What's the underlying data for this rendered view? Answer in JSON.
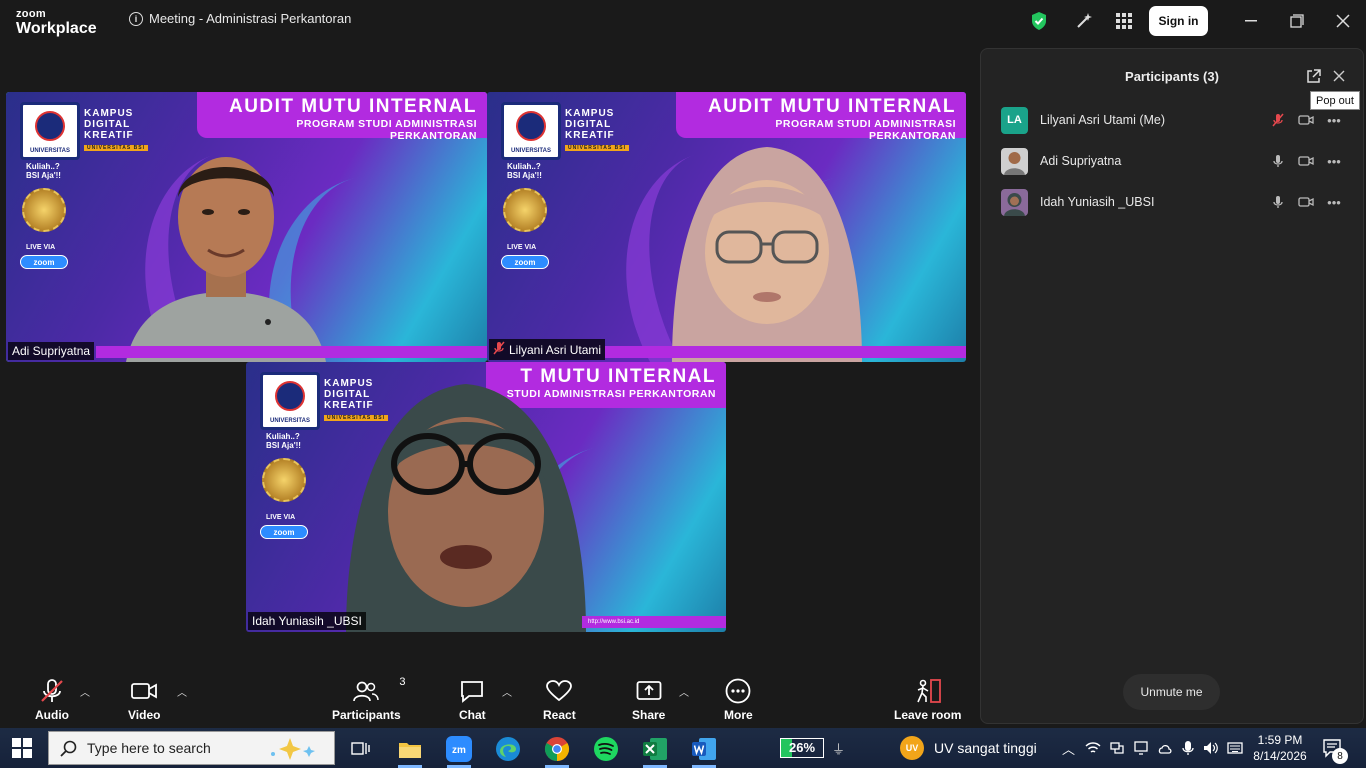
{
  "titlebar": {
    "logo_line1": "zoom",
    "logo_line2": "Workplace",
    "meeting_title": "Meeting - Administrasi Perkantoran",
    "signin_label": "Sign in"
  },
  "background_text": {
    "audit": "AUDIT MUTU INTERNAL",
    "audit_partial": "T MUTU INTERNAL",
    "program": "PROGRAM STUDI ADMINISTRASI PERKANTORAN",
    "program_partial": "STUDI ADMINISTRASI PERKANTORAN",
    "kampus": "KAMPUS",
    "digital": "DIGITAL",
    "kreatif": "KREATIF",
    "ubsi": "UNIVERSITAS BSI",
    "universitas": "UNIVERSITAS",
    "kuliah1": "Kuliah..?",
    "kuliah2": "BSI Aja'!!",
    "live_via": "LIVE VIA",
    "zoom": "zoom",
    "url": "http://www.bsi.ac.id"
  },
  "tiles": [
    {
      "name": "Adi Supriyatna",
      "muted": false
    },
    {
      "name": "Lilyani Asri Utami",
      "muted": true
    },
    {
      "name": "Idah Yuniasih _UBSI",
      "muted": false
    }
  ],
  "panel": {
    "title": "Participants (3)",
    "tooltip": "Pop out",
    "participants": [
      {
        "initials": "LA",
        "name": "Lilyani Asri Utami (Me)",
        "avatar_color": "#1aa38a",
        "muted": true
      },
      {
        "initials": "",
        "name": "Adi Supriyatna",
        "avatar_color": "#cfcfcf",
        "muted": false
      },
      {
        "initials": "",
        "name": "Idah Yuniasih _UBSI",
        "avatar_color": "#8a6a9a",
        "muted": false
      }
    ],
    "unmute_label": "Unmute me"
  },
  "toolbar": {
    "audio": "Audio",
    "video": "Video",
    "participants": "Participants",
    "participants_count": "3",
    "chat": "Chat",
    "react": "React",
    "share": "Share",
    "more": "More",
    "leave": "Leave room"
  },
  "taskbar": {
    "search_placeholder": "Type here to search",
    "battery": "26%",
    "weather": "UV sangat tinggi",
    "weather_badge": "UV",
    "time": "1:59 PM",
    "date": "8/14/2026",
    "notifications": "8"
  },
  "colors": {
    "accent_green": "#4be38a",
    "zoom_blue": "#2d8cff",
    "banner_purple": "#b22be0",
    "muted_red": "#e5484d"
  }
}
